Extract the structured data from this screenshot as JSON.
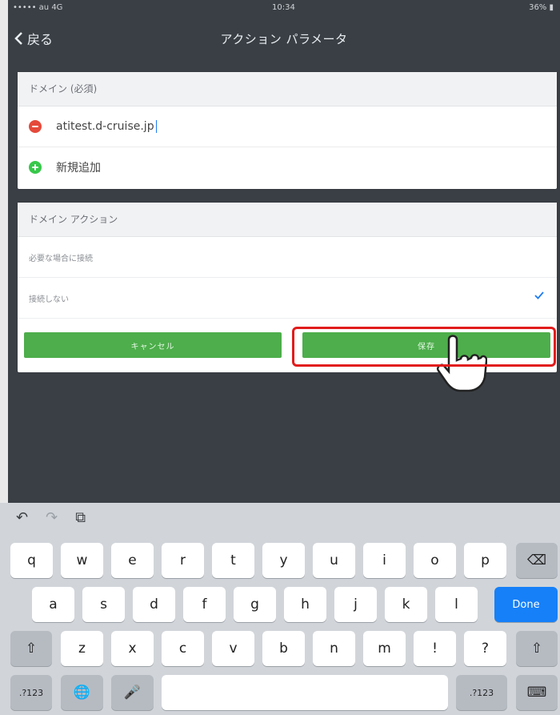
{
  "status": {
    "left": "••••• au 4G",
    "time": "10:34",
    "battery": "36% ▮"
  },
  "nav": {
    "back": "戻る",
    "title": "アクション パラメータ"
  },
  "domain_section": {
    "title": "ドメイン (必須)",
    "items": [
      "atitest.d-cruise.jp"
    ],
    "add_label": "新規追加"
  },
  "action_section": {
    "title": "ドメイン アクション",
    "options": [
      "必要な場合に接続",
      "接続しない"
    ],
    "selected_index": 1
  },
  "buttons": {
    "cancel": "キャンセル",
    "save": "保存"
  },
  "keyboard": {
    "row1": [
      "q",
      "w",
      "e",
      "r",
      "t",
      "y",
      "u",
      "i",
      "o",
      "p"
    ],
    "row2": [
      "a",
      "s",
      "d",
      "f",
      "g",
      "h",
      "j",
      "k",
      "l"
    ],
    "row3": [
      "z",
      "x",
      "c",
      "v",
      "b",
      "n",
      "m",
      "!",
      "?"
    ],
    "done": "Done",
    "numkey": ".?123"
  },
  "colors": {
    "accent_green": "#4dae4b",
    "highlight_red": "#e21b1b",
    "keyboard_blue": "#1680f8"
  }
}
